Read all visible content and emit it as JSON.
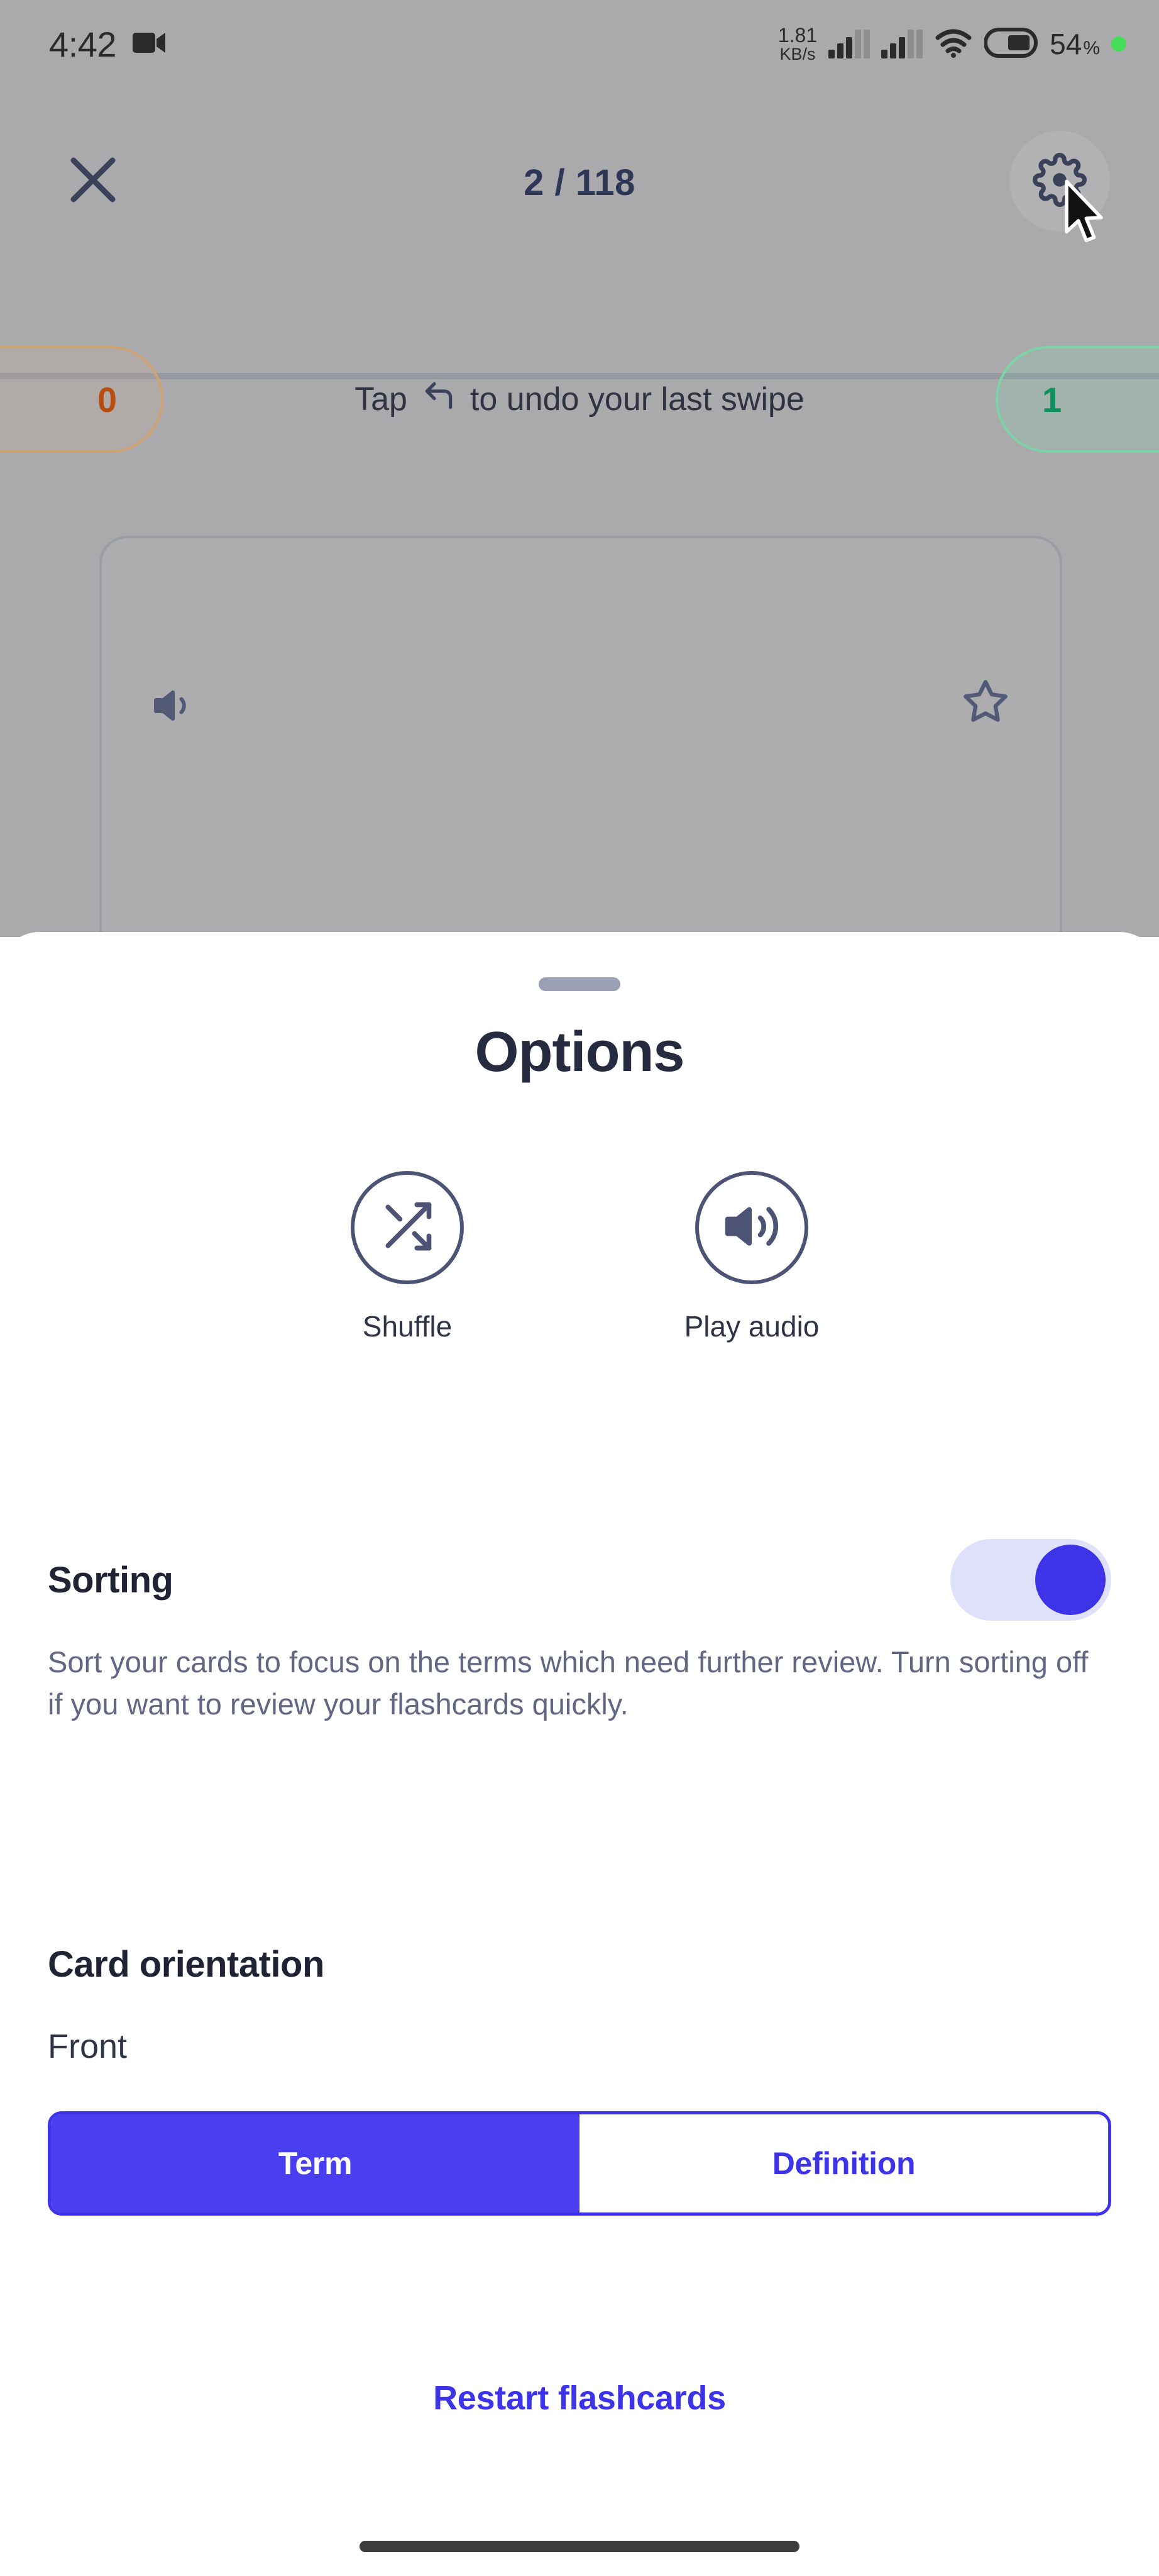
{
  "status_bar": {
    "clock": "4:42",
    "recording_icon": "video-camera-icon",
    "net_speed_value": "1.81",
    "net_speed_unit": "KB/s",
    "signal_icon_1": "cellular-signal-icon",
    "signal_icon_2": "cellular-signal-icon",
    "wifi_icon": "wifi-icon",
    "battery_icon": "battery-icon",
    "battery_percent": "54",
    "battery_percent_symbol": "%",
    "recording_dot": "recording-dot-icon"
  },
  "top_bar": {
    "close_icon": "close-icon",
    "counter": "2 / 118",
    "settings_icon": "gear-icon",
    "cursor": "mouse-pointer-icon"
  },
  "progress_row": {
    "missed_count": "0",
    "known_count": "1",
    "undo_prefix": "Tap",
    "undo_icon": "undo-arrow-icon",
    "undo_suffix": "to undo your last swipe"
  },
  "flashcard": {
    "audio_icon": "speaker-icon",
    "star_icon": "star-outline-icon"
  },
  "sheet": {
    "handle": "drag-handle",
    "title": "Options",
    "actions": [
      {
        "icon": "shuffle-icon",
        "label": "Shuffle"
      },
      {
        "icon": "speaker-icon",
        "label": "Play audio"
      }
    ],
    "sorting": {
      "title": "Sorting",
      "toggle_state": "on",
      "description": "Sort your cards to focus on the terms which need further review. Turn sorting off if you want to review your flashcards quickly."
    },
    "orientation": {
      "title": "Card orientation",
      "value_label": "Front",
      "options": [
        {
          "label": "Term",
          "selected": true
        },
        {
          "label": "Definition",
          "selected": false
        }
      ]
    },
    "restart_label": "Restart flashcards"
  },
  "colors": {
    "accent_blue": "#3d33e8",
    "accent_blue_fill": "#4a3ff0",
    "toggle_track": "#dfe1fb",
    "missed_border": "#cfa274",
    "missed_text": "#b84d12",
    "known_border": "#7dd3a8",
    "known_text": "#0c9160",
    "backdrop": "#aaaaad",
    "icon_dark": "#4d5375",
    "heading": "#1f2333",
    "body_text": "#616782",
    "recording_green": "#44dd55"
  }
}
